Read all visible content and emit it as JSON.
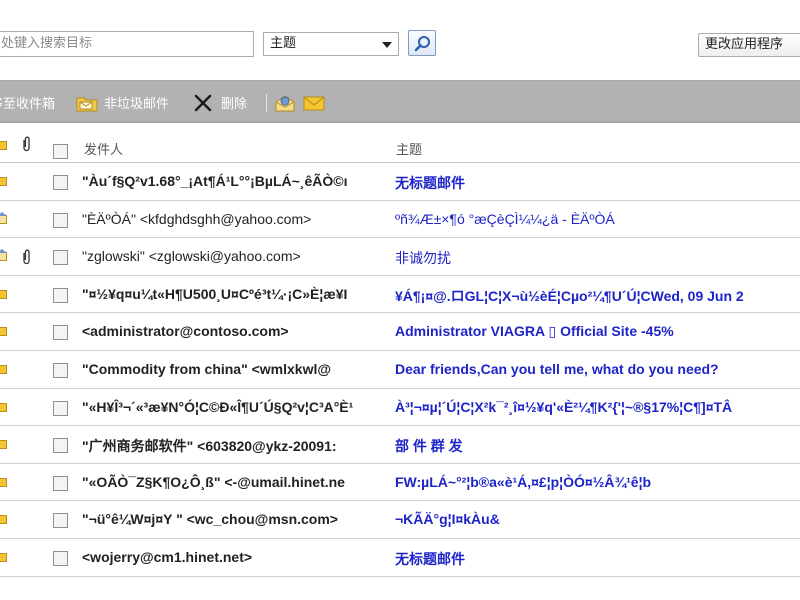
{
  "search": {
    "placeholder": "处键入搜索目标",
    "scope_value": "主题"
  },
  "header": {
    "apply_label": "更改应用程序"
  },
  "toolbar": {
    "items": [
      {
        "label": "移至收件箱"
      },
      {
        "label": "非垃圾邮件"
      },
      {
        "label": "删除"
      }
    ]
  },
  "columns": {
    "sender": "发件人",
    "subject": "主题"
  },
  "messages": [
    {
      "sender": "\"Àu´f§Q²v1.68°_¡At¶Á¹L°°¡BµLÁ~¸êÃÒ©ı",
      "subject": "无标题邮件",
      "unread": true,
      "attachment": false
    },
    {
      "sender": "\"ÈÄºÒÁ\" <kfdghdsghh@yahoo.com>",
      "subject": "ºñ¾Æ±×¶ó °æÇèÇÌ¼¼¿ä - ÈÄºÒÁ",
      "unread": false,
      "attachment": false
    },
    {
      "sender": "\"zglowski\" <zglowski@yahoo.com>",
      "subject": "非诚勿扰",
      "unread": false,
      "attachment": true
    },
    {
      "sender": "\"¤½¥q¤u¼t«H¶U500¸U¤Cºé³t¼·¡C»È¦æ¥I",
      "subject": "¥Á¶¡¤@.ロGL¦C¦X¬ù½èÉ¦Cµo²¼¶U´Ú¦CWed, 09 Jun 2",
      "unread": true,
      "attachment": false
    },
    {
      "sender": "<administrator@contoso.com>",
      "subject": "Administrator VIAGRA ▯ Official Site -45%",
      "unread": true,
      "attachment": false
    },
    {
      "sender": "\"Commodity from china\" <wmlxkwl@",
      "subject": "Dear friends,Can you tell me, what do you need?",
      "unread": true,
      "attachment": false
    },
    {
      "sender": "\"«H¥Î³¬´«³æ¥N°Ó¦C©Ð«Î¶U´Ú§Q²v¦C³A°È¹",
      "subject": "À³¦¬¤µ¦´Ú¦C¦X²k¯²¸î¤½¥q'«È²¼¶K²{'¦~®§17%¦C¶]¤TÂ",
      "unread": true,
      "attachment": false
    },
    {
      "sender": "\"广州商务邮软件\" <603820@ykz-20091:",
      "subject": "部 件 群 发",
      "unread": true,
      "attachment": false
    },
    {
      "sender": "\"«OÃÒ¯Z§K¶O¿Ô¸ß\" <-@umail.hinet.ne",
      "subject": "FW:µLÁ~°²¦b®a«è¹Á,¤£¦p¦ÒÓ¤½Â¾¹ê¦b",
      "unread": true,
      "attachment": false
    },
    {
      "sender": "\"¬ü°ê¼W¤j¤Y \" <wc_chou@msn.com>",
      "subject": "¬KÃÄ°g¦I¤kÀu&",
      "unread": true,
      "attachment": false
    },
    {
      "sender": "<wojerry@cm1.hinet.net>",
      "subject": "无标题邮件",
      "unread": true,
      "attachment": false
    }
  ],
  "colors": {
    "toolbar": "#b2b2b2",
    "subject_link": "#1e24c8",
    "envelope": "#f4c531"
  }
}
